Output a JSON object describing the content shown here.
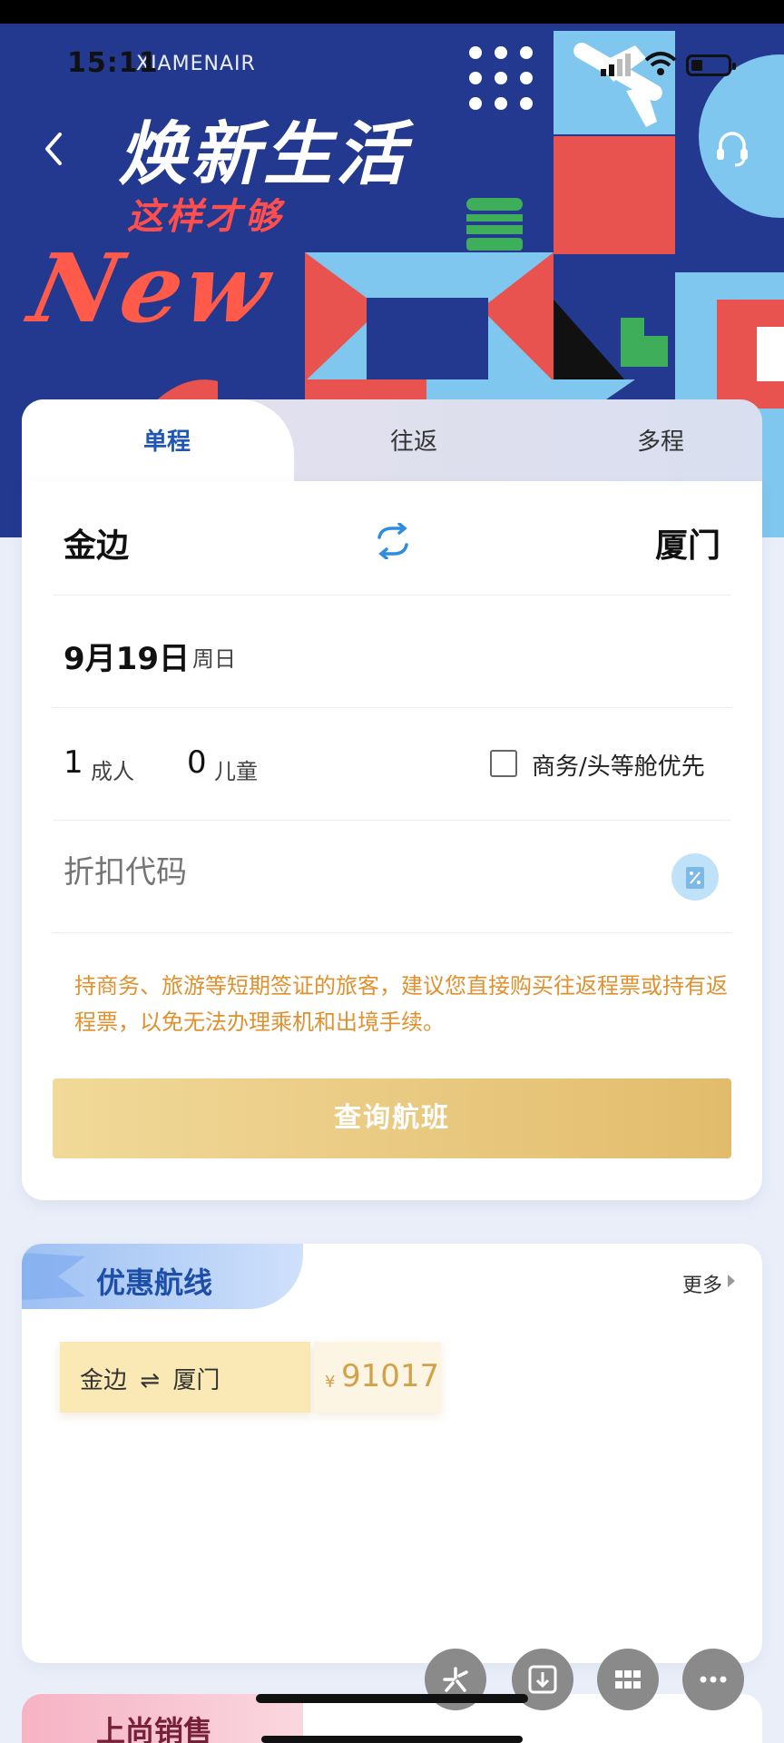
{
  "status_bar": {
    "time": "15:11",
    "brand": "XIAMENAIR"
  },
  "hero": {
    "title": "焕新生活",
    "subtitle": "这样才够",
    "script": "New"
  },
  "tabs": [
    {
      "label": "单程",
      "active": true
    },
    {
      "label": "往返",
      "active": false
    },
    {
      "label": "多程",
      "active": false
    }
  ],
  "search": {
    "from_city": "金边",
    "to_city": "厦门",
    "date": "9月19日",
    "weekday": "周日",
    "adults_count": "1",
    "adults_label": "成人",
    "children_count": "0",
    "children_label": "儿童",
    "business_priority_label": "商务/头等舱优先",
    "promo_placeholder": "折扣代码",
    "notice": "持商务、旅游等短期签证的旅客，建议您直接购买往返程票或持有返程票，以免无法办理乘机和出境手续。",
    "search_button": "查询航班"
  },
  "routes": {
    "title": "优惠航线",
    "more_label": "更多",
    "items": [
      {
        "from": "金边",
        "to": "厦门",
        "arrow": "⇌",
        "currency": "¥",
        "price": "91017"
      }
    ]
  },
  "next_section": {
    "title": "上尚销售"
  },
  "colors": {
    "hero_blue": "#23388f",
    "active_tab": "#1f56b8",
    "notice_orange": "#e0912f",
    "button_gold": "#e2bc6c"
  },
  "icons": [
    "back-arrow-icon",
    "headset-icon",
    "swap-icon",
    "discount-icon",
    "sparkle-icon",
    "download-icon",
    "grid-icon",
    "more-dots-icon"
  ]
}
